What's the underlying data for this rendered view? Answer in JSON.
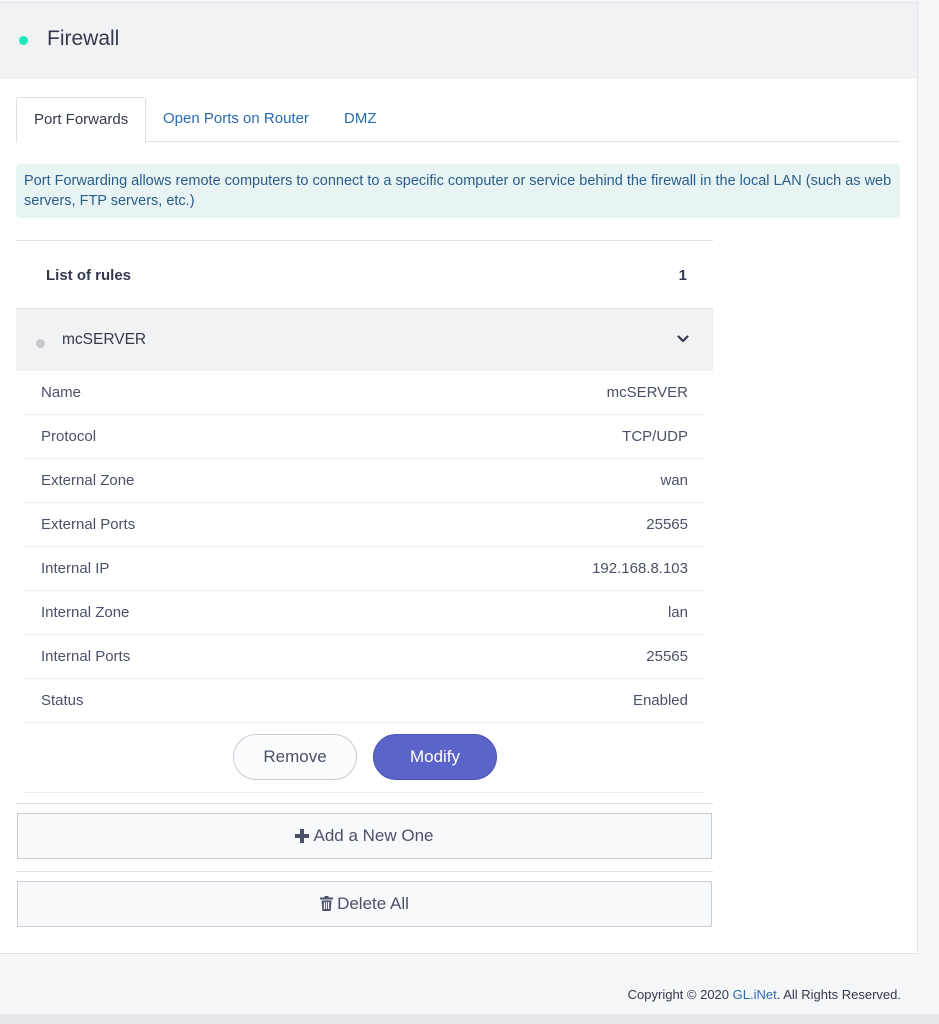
{
  "header": {
    "title": "Firewall",
    "status_color": "#1de9b6"
  },
  "tabs": [
    {
      "label": "Port Forwards",
      "active": true
    },
    {
      "label": "Open Ports on Router",
      "active": false
    },
    {
      "label": "DMZ",
      "active": false
    }
  ],
  "info": "Port Forwarding allows remote computers to connect to a specific computer or service behind the firewall in the local LAN (such as web servers, FTP servers, etc.)",
  "rules": {
    "label": "List of rules",
    "count": "1",
    "items": [
      {
        "name": "mcSERVER",
        "status_color": "#c8c9cc",
        "details": [
          {
            "key": "Name",
            "value": "mcSERVER"
          },
          {
            "key": "Protocol",
            "value": "TCP/UDP"
          },
          {
            "key": "External Zone",
            "value": "wan"
          },
          {
            "key": "External Ports",
            "value": "25565"
          },
          {
            "key": "Internal IP",
            "value": "192.168.8.103"
          },
          {
            "key": "Internal Zone",
            "value": "lan"
          },
          {
            "key": "Internal Ports",
            "value": "25565"
          },
          {
            "key": "Status",
            "value": "Enabled"
          }
        ],
        "remove_label": "Remove",
        "modify_label": "Modify"
      }
    ]
  },
  "add_label": "Add a New One",
  "delete_all_label": "Delete All",
  "footer": {
    "prefix": "Copyright © 2020 ",
    "link": "GL.iNet",
    "suffix": ". All Rights Reserved."
  },
  "colors": {
    "accent": "#5b64c8",
    "link": "#2a6bb0"
  }
}
